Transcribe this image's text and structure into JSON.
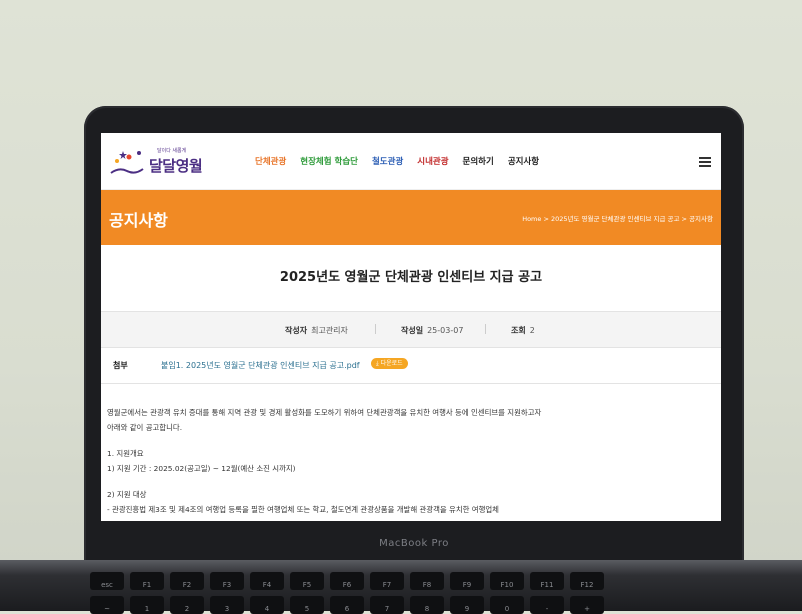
{
  "site": {
    "logo_tagline": "달이다 새롭게",
    "logo_text": "달달영월",
    "nav": [
      {
        "label": "단체관광",
        "color": "#e8762b"
      },
      {
        "label": "현장체험 학습단",
        "color": "#2e9b3a"
      },
      {
        "label": "철도관광",
        "color": "#2d5fb5"
      },
      {
        "label": "시내관광",
        "color": "#c22b2b"
      },
      {
        "label": "문의하기",
        "color": "#222222"
      },
      {
        "label": "공지사항",
        "color": "#222222"
      }
    ]
  },
  "banner": {
    "title": "공지사항",
    "breadcrumb": "Home > 2025년도 영월군 단체관광 인센티브 지급 공고 > 공지사항",
    "color": "#f18a24"
  },
  "post": {
    "title": "2025년도 영월군 단체관광 인센티브 지급 공고",
    "author_label": "작성자",
    "author": "최고관리자",
    "date_label": "작성일",
    "date": "25-03-07",
    "views_label": "조회",
    "views": "2",
    "attach_label": "첨부",
    "attach_file": "붙임1. 2025년도 영월군 단체관광 인센티브 지급 공고.pdf",
    "download_label": "다운로드",
    "body": [
      "영월군에서는 관광객 유치 증대를 통해 지역 관광 및 경제 활성화를 도모하기 위하여 단체관광객을 유치한 여행사 등에 인센티브를 지원하고자",
      "아래와 같이 공고합니다.",
      "",
      "1. 지원개요",
      "1) 지원 기간 : 2025.02(공고일) ~ 12월(예산 소진 시까지)",
      "",
      "2) 지원 대상",
      "- 관광진흥법 제3조 및 제4조의 여행업 등록을 필한 여행업체 또는 학교, 철도연계 관광상품을 개발해 관광객을 유치한 여행업체"
    ]
  },
  "device": {
    "brand": "MacBook Pro",
    "keys_row1": [
      "esc",
      "F1",
      "F2",
      "F3",
      "F4",
      "F5",
      "F6",
      "F7",
      "F8",
      "F9",
      "F10",
      "F11",
      "F12"
    ],
    "keys_row2": [
      "~",
      "1",
      "2",
      "3",
      "4",
      "5",
      "6",
      "7",
      "8",
      "9",
      "0",
      "-",
      "+"
    ]
  }
}
